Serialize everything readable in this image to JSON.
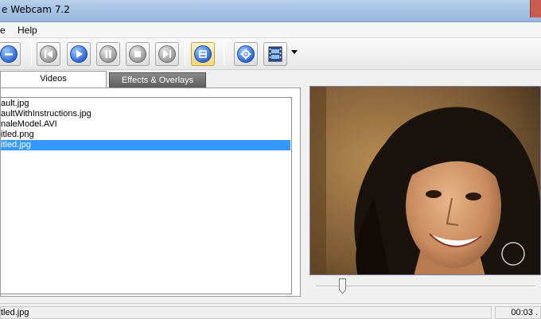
{
  "window": {
    "title": "e Webcam 7.2"
  },
  "menubar": {
    "items": [
      "e",
      "Help"
    ]
  },
  "toolbar": {
    "buttons": [
      {
        "name": "minus-icon"
      },
      {
        "name": "skip-back-icon"
      },
      {
        "name": "play-icon"
      },
      {
        "name": "pause-icon"
      },
      {
        "name": "stop-icon"
      },
      {
        "name": "skip-forward-icon"
      },
      {
        "name": "fit-window-icon",
        "active": true
      },
      {
        "name": "gear-icon"
      },
      {
        "name": "film-icon"
      }
    ]
  },
  "tabs": [
    {
      "label": "Videos",
      "selected": true
    },
    {
      "label": "Effects & Overlays",
      "selected": false
    }
  ],
  "file_list": {
    "items": [
      {
        "label": "ault.jpg",
        "selected": false
      },
      {
        "label": "aultWithInstructions.jpg",
        "selected": false
      },
      {
        "label": "naleModel.AVI",
        "selected": false
      },
      {
        "label": "itled.png",
        "selected": false
      },
      {
        "label": "itled.jpg",
        "selected": true
      }
    ]
  },
  "preview": {
    "position_fraction": 0.12
  },
  "status": {
    "text": "tled.jpg",
    "time": "00:03 ."
  },
  "colors": {
    "selection": "#3399ff",
    "titlebar": "#a7c4e5",
    "accent_blue": "#2e6ad4"
  }
}
